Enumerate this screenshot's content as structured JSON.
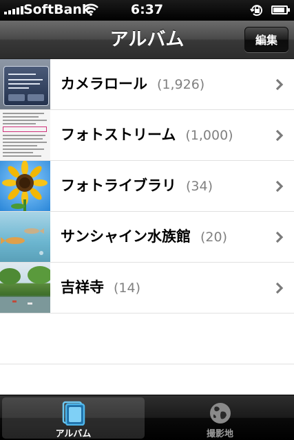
{
  "status_bar": {
    "carrier": "SoftBank",
    "time": "6:37",
    "battery_level": 0.9
  },
  "nav": {
    "title": "アルバム",
    "edit_label": "編集"
  },
  "albums": [
    {
      "name": "カメラロール",
      "count": "(1,926)"
    },
    {
      "name": "フォトストリーム",
      "count": "(1,000)"
    },
    {
      "name": "フォトライブラリ",
      "count": "(34)"
    },
    {
      "name": "サンシャイン水族館",
      "count": "(20)"
    },
    {
      "name": "吉祥寺",
      "count": "(14)"
    }
  ],
  "tabs": [
    {
      "label": "アルバム",
      "icon": "albums-icon",
      "selected": true
    },
    {
      "label": "撮影地",
      "icon": "globe-icon",
      "selected": false
    }
  ],
  "colors": {
    "nav_bar": "#4a4a4a",
    "count_text": "#808080",
    "tab_active_icon": "#4fb6ea"
  }
}
